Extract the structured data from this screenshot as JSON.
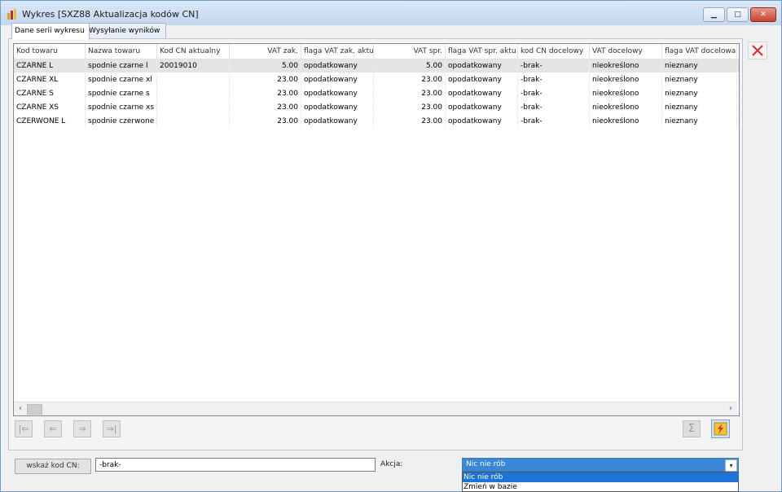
{
  "window": {
    "title": "Wykres [SXZ88 Aktualizacja kodów CN]",
    "controls": {
      "minimize": "▁",
      "maximize": "□",
      "close": "✕"
    }
  },
  "tabs": [
    {
      "label": "Dane serii wykresu"
    },
    {
      "label": "Wysyłanie wyników"
    }
  ],
  "grid": {
    "columns": [
      "Kod towaru",
      "Nazwa towaru",
      "Kod CN aktualny",
      "VAT zak.",
      "flaga VAT zak. aktu",
      "VAT spr.",
      "flaga VAT spr. aktu",
      "kod CN docelowy",
      "VAT docelowy",
      "flaga VAT docelowa"
    ],
    "rows": [
      [
        "CZARNE L",
        "spodnie czarne l",
        "20019010",
        "5.00",
        "opodatkowany",
        "5.00",
        "opodatkowany",
        "-brak-",
        "nieokreślono",
        "nieznany"
      ],
      [
        "CZARNE XL",
        "spodnie czarne xl",
        "",
        "23.00",
        "opodatkowany",
        "23.00",
        "opodatkowany",
        "-brak-",
        "nieokreślono",
        "nieznany"
      ],
      [
        "CZARNE S",
        "spodnie czarne s",
        "",
        "23.00",
        "opodatkowany",
        "23.00",
        "opodatkowany",
        "-brak-",
        "nieokreślono",
        "nieznany"
      ],
      [
        "CZARNE XS",
        "spodnie czarne xs",
        "",
        "23.00",
        "opodatkowany",
        "23.00",
        "opodatkowany",
        "-brak-",
        "nieokreślono",
        "nieznany"
      ],
      [
        "CZERWONE L",
        "spodnie czerwone l",
        "",
        "23.00",
        "opodatkowany",
        "23.00",
        "opodatkowany",
        "-brak-",
        "nieokreślono",
        "nieznany"
      ]
    ]
  },
  "toolbar": {
    "first": "|⇐",
    "prev": "⇐",
    "next": "⇒",
    "last": "⇒|",
    "sum": "Σ"
  },
  "bottom": {
    "cn_button": "wskaż kod CN:",
    "cn_value": "-brak-",
    "akcja_label": "Akcja:",
    "akcja_selected": "Nic nie rób",
    "akcja_options": [
      "Nic nie rób",
      "Zmień w bazie"
    ]
  },
  "colors": {
    "selection": "#3a86d8",
    "close_button": "#c8432e"
  }
}
